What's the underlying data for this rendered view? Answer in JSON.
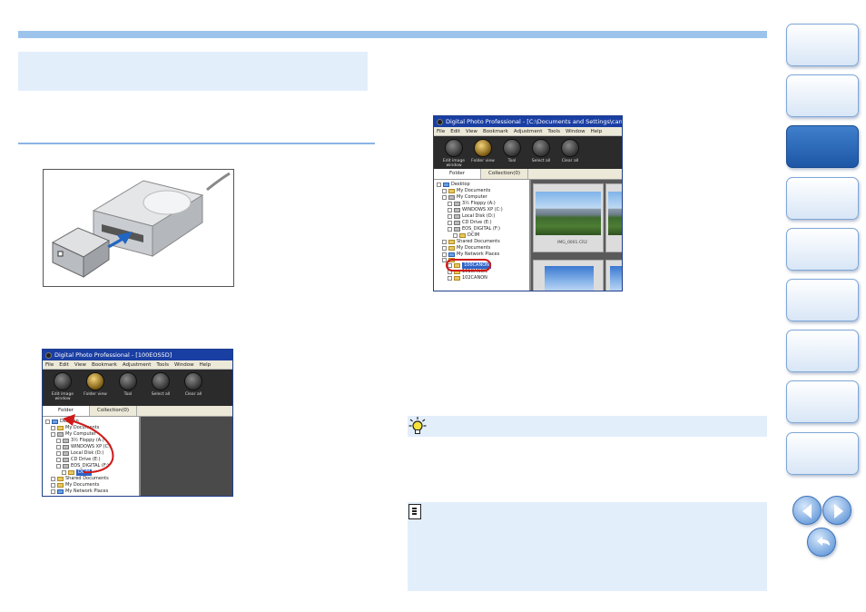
{
  "left_screenshot": {
    "title": "Digital Photo Professional - [100EOS5D]",
    "menu": [
      "File",
      "Edit",
      "View",
      "Bookmark",
      "Adjustment",
      "Tools",
      "Window",
      "Help"
    ],
    "toolbar": [
      {
        "label": "Edit image window"
      },
      {
        "label": "Folder view"
      },
      {
        "label": "Tool"
      },
      {
        "label": "Select all"
      },
      {
        "label": "Clear all"
      }
    ],
    "tabs": [
      "Folder",
      "Collection(0)"
    ],
    "tree": [
      {
        "label": "Desktop",
        "indent": 0,
        "icon": "blue"
      },
      {
        "label": "My Documents",
        "indent": 1,
        "icon": "yellow"
      },
      {
        "label": "My Computer",
        "indent": 1,
        "icon": "grey"
      },
      {
        "label": "3½ Floppy (A:)",
        "indent": 2,
        "icon": "grey"
      },
      {
        "label": "WINDOWS XP (C:)",
        "indent": 2,
        "icon": "grey"
      },
      {
        "label": "Local Disk (D:)",
        "indent": 2,
        "icon": "grey"
      },
      {
        "label": "CD Drive (E:)",
        "indent": 2,
        "icon": "grey"
      },
      {
        "label": "EOS_DIGITAL (F:)",
        "indent": 2,
        "icon": "grey"
      },
      {
        "label": "DCIM",
        "indent": 3,
        "icon": "yellow",
        "highlight": true
      },
      {
        "label": "Shared Documents",
        "indent": 1,
        "icon": "yellow"
      },
      {
        "label": "My Documents",
        "indent": 1,
        "icon": "yellow"
      },
      {
        "label": "My Network Places",
        "indent": 1,
        "icon": "blue"
      }
    ]
  },
  "right_screenshot": {
    "title": "Digital Photo Professional - [C:\\Documents and Settings\\canon\\My Documents",
    "menu": [
      "File",
      "Edit",
      "View",
      "Bookmark",
      "Adjustment",
      "Tools",
      "Window",
      "Help"
    ],
    "toolbar": [
      {
        "label": "Edit image window"
      },
      {
        "label": "Folder view"
      },
      {
        "label": "Tool"
      },
      {
        "label": "Select all"
      },
      {
        "label": "Clear all"
      }
    ],
    "tabs": [
      "Folder",
      "Collection(0)"
    ],
    "tree": [
      {
        "label": "Desktop",
        "indent": 0,
        "icon": "blue"
      },
      {
        "label": "My Documents",
        "indent": 1,
        "icon": "yellow"
      },
      {
        "label": "My Computer",
        "indent": 1,
        "icon": "grey"
      },
      {
        "label": "3½ Floppy (A:)",
        "indent": 2,
        "icon": "grey"
      },
      {
        "label": "WINDOWS XP (C:)",
        "indent": 2,
        "icon": "grey"
      },
      {
        "label": "Local Disk (D:)",
        "indent": 2,
        "icon": "grey"
      },
      {
        "label": "CD Drive (E:)",
        "indent": 2,
        "icon": "grey"
      },
      {
        "label": "EOS_DIGITAL (F:)",
        "indent": 2,
        "icon": "grey"
      },
      {
        "label": "DCIM",
        "indent": 3,
        "icon": "yellow"
      },
      {
        "label": "Shared Documents",
        "indent": 1,
        "icon": "yellow"
      },
      {
        "label": "My Documents",
        "indent": 1,
        "icon": "yellow"
      },
      {
        "label": "My Network Places",
        "indent": 1,
        "icon": "blue"
      },
      {
        "label": "",
        "indent": 1,
        "icon": "yellow"
      },
      {
        "label": "100CANON",
        "indent": 2,
        "icon": "yellow",
        "selected": true
      },
      {
        "label": "101CANON",
        "indent": 2,
        "icon": "yellow"
      },
      {
        "label": "102CANON",
        "indent": 2,
        "icon": "yellow"
      }
    ],
    "thumb_label": "IMG_0001.CR2"
  },
  "side_tabs": [
    {
      "name": "side-tab-1",
      "active": false
    },
    {
      "name": "side-tab-2",
      "active": false
    },
    {
      "name": "side-tab-3",
      "active": true
    },
    {
      "name": "side-tab-4",
      "active": false
    },
    {
      "name": "side-tab-5",
      "active": false
    },
    {
      "name": "side-tab-6",
      "active": false
    },
    {
      "name": "side-tab-7",
      "active": false
    },
    {
      "name": "side-tab-8",
      "active": false
    },
    {
      "name": "side-tab-9",
      "active": false
    }
  ],
  "colors": {
    "accent": "#9cc3ec",
    "panel": "#e3eefb",
    "active_tab": "#1d57a6",
    "callout": "#d01818"
  }
}
